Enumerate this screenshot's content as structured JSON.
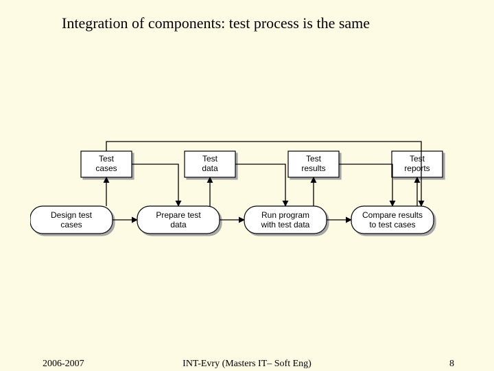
{
  "title": "Integration of components: test process is the same",
  "footer": {
    "left": "2006-2007",
    "center": "INT-Evry (Masters IT– Soft Eng)",
    "right": "8"
  },
  "artifacts": [
    {
      "id": "a0",
      "label": "Test\ncases"
    },
    {
      "id": "a1",
      "label": "Test\ndata"
    },
    {
      "id": "a2",
      "label": "Test\nresults"
    },
    {
      "id": "a3",
      "label": "Test\nreports"
    }
  ],
  "processes": [
    {
      "id": "p0",
      "label": "Design test\ncases"
    },
    {
      "id": "p1",
      "label": "Prepare test\ndata"
    },
    {
      "id": "p2",
      "label": "Run program\nwith test data"
    },
    {
      "id": "p3",
      "label": "Compare results\nto test cases"
    }
  ]
}
